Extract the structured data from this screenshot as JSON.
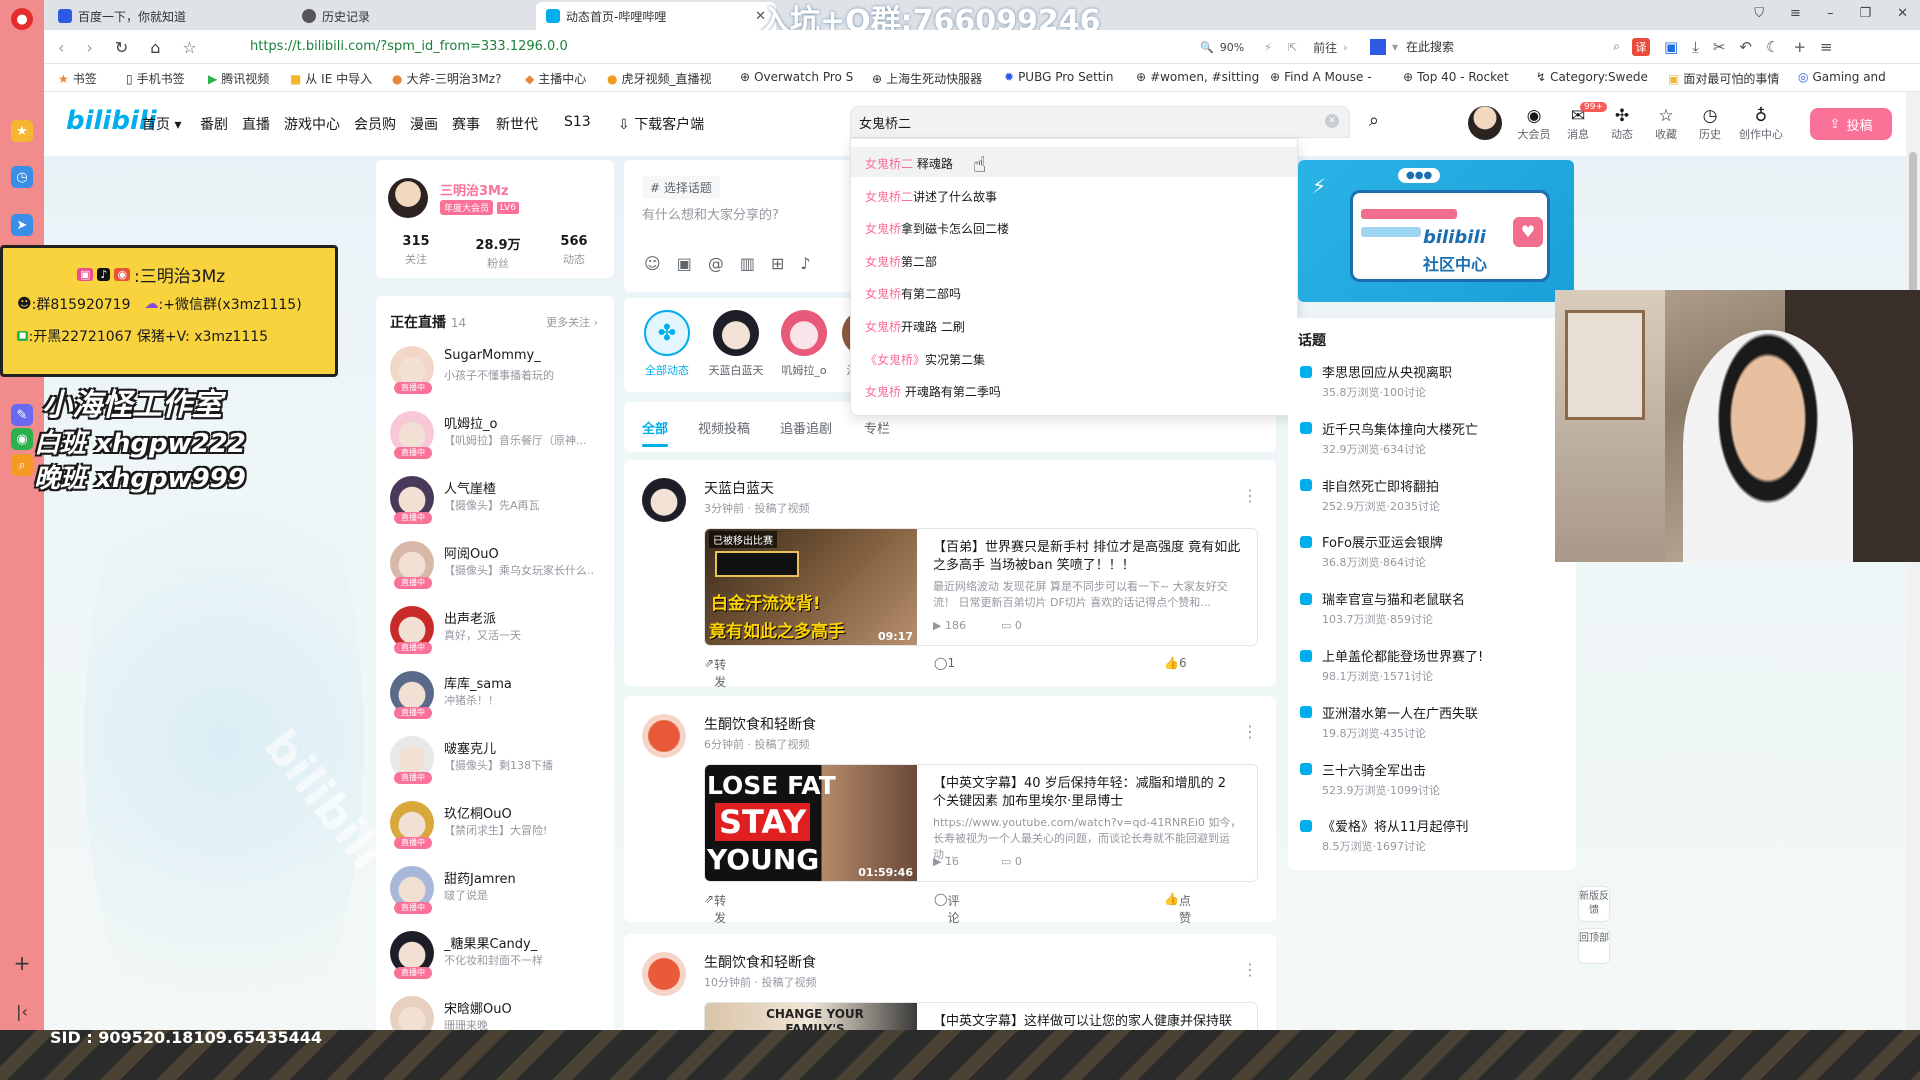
{
  "browser": {
    "tabs": [
      {
        "title": "百度一下，你就知道"
      },
      {
        "title": "历史记录"
      },
      {
        "title": "动态首页-哔哩哔哩"
      }
    ],
    "overlay_title": "入坑+Q群:766099246",
    "url": "https://t.bilibili.com/?spm_id_from=333.1296.0.0",
    "zoom": "90%",
    "forward_label": "前往",
    "search_placeholder": "在此搜索",
    "bookmarks": [
      "书签",
      "手机书签",
      "腾讯视频",
      "从 IE 中导入",
      "大斧-三明治3Mz?",
      "主播中心",
      "虎牙视频_直播视",
      "Overwatch Pro S",
      "上海生死动快服器",
      "PUBG Pro Settin",
      "#women, #sitting",
      "Find A Mouse -",
      "Top 40 - Rocket",
      "Category:Swede",
      "面对最可怕的事情",
      "Gaming and"
    ]
  },
  "bili_nav": {
    "logo": "bilibili",
    "links": [
      "首页",
      "番剧",
      "直播",
      "游戏中心",
      "会员购",
      "漫画",
      "赛事",
      "新世代",
      "S13",
      "下载客户端"
    ],
    "search_value": "女鬼桥二",
    "right_icons": [
      {
        "label": "大会员",
        "icon": "vip-icon"
      },
      {
        "label": "消息",
        "icon": "message-icon",
        "badge": "99+"
      },
      {
        "label": "动态",
        "icon": "dynamic-icon"
      },
      {
        "label": "收藏",
        "icon": "star-icon"
      },
      {
        "label": "历史",
        "icon": "history-icon"
      },
      {
        "label": "创作中心",
        "icon": "bulb-icon"
      }
    ],
    "upload_label": "投稿"
  },
  "search_suggestions": [
    {
      "hl": "女鬼桥二",
      "rest": " 释魂路"
    },
    {
      "hl": "女鬼桥二",
      "rest": "讲述了什么故事"
    },
    {
      "hl": "女鬼桥",
      "rest": "拿到磁卡怎么回二楼"
    },
    {
      "hl": "女鬼桥",
      "rest": "第二部"
    },
    {
      "hl": "女鬼桥",
      "rest": "有第二部吗"
    },
    {
      "hl": "女鬼桥",
      "rest": "开魂路 二刷"
    },
    {
      "hl": "《女鬼桥》",
      "rest": "实况第二集"
    },
    {
      "hl": "女鬼桥",
      "rest": " 开魂路有第二季吗"
    }
  ],
  "profile": {
    "name": "三明治3Mz",
    "badge": "年度大会员",
    "level": "LV6",
    "stats": [
      {
        "value": "315",
        "label": "关注"
      },
      {
        "value": "28.9万",
        "label": "粉丝"
      },
      {
        "value": "566",
        "label": "动态"
      }
    ]
  },
  "live": {
    "title": "正在直播",
    "count": "14",
    "more": "更多关注",
    "tag": "直播中",
    "items": [
      {
        "name": "SugarMommy_",
        "desc": "小孩子不懂事播着玩的"
      },
      {
        "name": "叽姆拉_o",
        "desc": "【叽姆拉】音乐餐厅（原神..."
      },
      {
        "name": "人气崖楂",
        "desc": "【摄像头】先A再瓦"
      },
      {
        "name": "阿阅OuO",
        "desc": "【摄像头】乘乌女玩家长什么..."
      },
      {
        "name": "出声老派",
        "desc": "真好，又活一天"
      },
      {
        "name": "库库_sama",
        "desc": "冲猪杀！！"
      },
      {
        "name": "啵塞克儿",
        "desc": "【摄像头】剩138下播"
      },
      {
        "name": "玖亿桐OuO",
        "desc": "【禁闭求生】大冒险!"
      },
      {
        "name": "甜药Jamren",
        "desc": "啵了说是"
      },
      {
        "name": "_糖果果Candy_",
        "desc": "不化妆和封面不一样"
      },
      {
        "name": "宋晗娜OuO",
        "desc": "珊珊来晚"
      }
    ]
  },
  "composer": {
    "topic_label": "选择话题",
    "placeholder": "有什么想和大家分享的?"
  },
  "follow_row": [
    {
      "name": "全部动态"
    },
    {
      "name": "天蓝白蓝天"
    },
    {
      "name": "叽姆拉_o"
    },
    {
      "name": "汉"
    }
  ],
  "feed_tabs": [
    "全部",
    "视频投稿",
    "追番追剧",
    "专栏"
  ],
  "posts": [
    {
      "author": "天蓝白蓝天",
      "meta": "3分钟前 · 投稿了视频",
      "thumb_top": "已被移出比赛",
      "thumb_text1": "白金汗流浃背!",
      "thumb_text2": "竟有如此之多高手",
      "duration": "09:17",
      "title": "【百弟】世界赛只是新手村 排位才是高强度 竟有如此之多高手 当场被ban 笑喷了！！！",
      "desc": "最近网络波动 发现花屏 算是不同步可以看一下~ 大家友好交流！ 日常更新百弟切片 DF切片 喜欢的话记得点个赞和...",
      "plays": "186",
      "comments_count": "0",
      "share": "转发",
      "comment": "1",
      "like": "6"
    },
    {
      "author": "生酮饮食和轻断食",
      "meta": "6分钟前 · 投稿了视频",
      "thumb_text1": "LOSE FAT",
      "thumb_text2": "STAY",
      "thumb_text3": "YOUNG",
      "duration": "01:59:46",
      "title": "【中英文字幕】40 岁后保持年轻：减脂和增肌的 2 个关键因素  加布里埃尔·里昂博士",
      "desc": "https://www.youtube.com/watch?v=qd-41RNREi0 如今，长寿被视为一个人最关心的问题，而谈论长寿就不能回避到运动...",
      "plays": "16",
      "comments_count": "0",
      "share": "转发",
      "comment": "评论",
      "like": "点赞"
    },
    {
      "author": "生酮饮食和轻断食",
      "meta": "10分钟前 · 投稿了视频",
      "thumb_text1": "CHANGE YOUR FAMILY'S",
      "title": "【中英文字幕】这样做可以让您的家人健康并保持联"
    }
  ],
  "community": {
    "label": "社区中心",
    "logo": "bilibili"
  },
  "topics": {
    "title": "话题",
    "items": [
      {
        "name": "李思思回应从央视离职",
        "stats": "35.8万浏览·100讨论"
      },
      {
        "name": "近千只鸟集体撞向大楼死亡",
        "stats": "32.9万浏览·634讨论"
      },
      {
        "name": "非自然死亡即将翻拍",
        "stats": "252.9万浏览·2035讨论"
      },
      {
        "name": "FoFo展示亚运会银牌",
        "stats": "36.8万浏览·864讨论"
      },
      {
        "name": "瑞幸官宣与猫和老鼠联名",
        "stats": "103.7万浏览·859讨论"
      },
      {
        "name": "上单盖伦都能登场世界赛了!",
        "stats": "98.1万浏览·1571讨论"
      },
      {
        "name": "亚洲潜水第一人在广西失联",
        "stats": "19.8万浏览·435讨论"
      },
      {
        "name": "三十六骑全军出击",
        "stats": "523.9万浏览·1099讨论"
      },
      {
        "name": "《爱格》将从11月起停刊",
        "stats": "8.5万浏览·1697讨论"
      }
    ]
  },
  "side_buttons": [
    "新版反馈",
    "回顶部"
  ],
  "stream_overlay": {
    "line1": ":三明治3Mz",
    "line2a": ":群815920719",
    "line2b": ":+微信群(x3mz1115)",
    "line3": ":开黑22721067  保猪+V: x3mz1115",
    "studio": "小海怪工作室",
    "day": "白班 xhgpw222",
    "night": "晚班 xhgpw999",
    "sid": "SID : 909520.18109.65435444"
  },
  "colors": {
    "pink": "#fb7299",
    "blue": "#00aeec",
    "overlay_yellow": "#f8d33e"
  }
}
